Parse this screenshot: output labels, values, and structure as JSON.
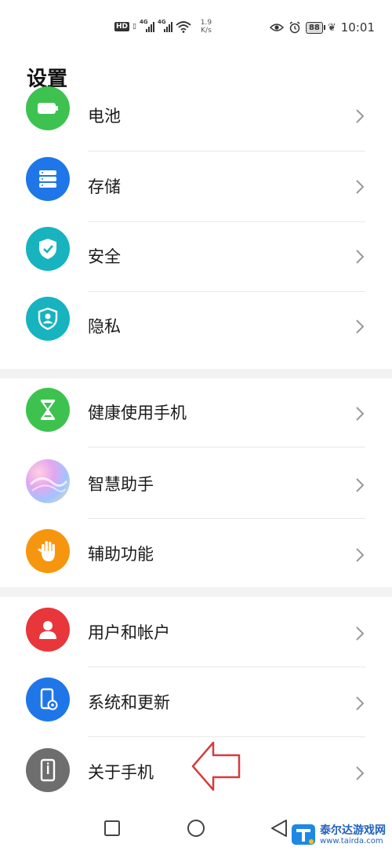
{
  "status_bar": {
    "hd": "HD",
    "net1": "4G",
    "net2": "4G",
    "speed_value": "1.9",
    "speed_unit": "K/s",
    "battery": "88",
    "time": "10:01"
  },
  "page": {
    "title": "设置"
  },
  "items": [
    {
      "label": "电池",
      "icon": "battery-icon",
      "color": "#3dc24f"
    },
    {
      "label": "存储",
      "icon": "storage-icon",
      "color": "#1f76e8"
    },
    {
      "label": "安全",
      "icon": "security-shield-icon",
      "color": "#17b3bf"
    },
    {
      "label": "隐私",
      "icon": "privacy-shield-icon",
      "color": "#17b3bf"
    },
    {
      "label": "健康使用手机",
      "icon": "hourglass-icon",
      "color": "#3dc24f"
    },
    {
      "label": "智慧助手",
      "icon": "smart-assistant-icon",
      "color": "#c9a3e6"
    },
    {
      "label": "辅助功能",
      "icon": "hand-icon",
      "color": "#f6960e"
    },
    {
      "label": "用户和帐户",
      "icon": "user-icon",
      "color": "#e8363a"
    },
    {
      "label": "系统和更新",
      "icon": "system-update-icon",
      "color": "#1f76e8"
    },
    {
      "label": "关于手机",
      "icon": "phone-info-icon",
      "color": "#6e6e6e"
    }
  ],
  "watermark": {
    "title": "泰尔达游戏网",
    "url": "www.tairda.com"
  }
}
